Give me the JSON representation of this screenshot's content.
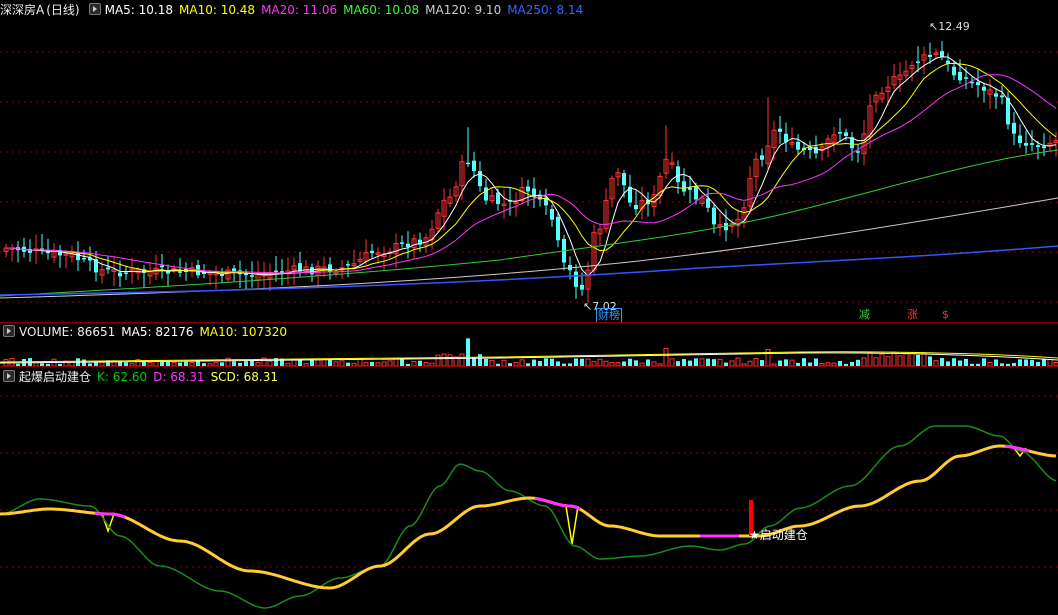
{
  "price_pane": {
    "stock_name": "深深房A",
    "period": "(日线)",
    "ma": [
      {
        "key": "MA5",
        "label": "MA5: 10.18",
        "color": "#ffffff"
      },
      {
        "key": "MA10",
        "label": "MA10: 10.48",
        "color": "#ffff00"
      },
      {
        "key": "MA20",
        "label": "MA20: 11.06",
        "color": "#ff00ff"
      },
      {
        "key": "MA60",
        "label": "MA60: 10.08",
        "color": "#00ff00"
      },
      {
        "key": "MA120",
        "label": "MA120: 9.10",
        "color": "#cccccc"
      },
      {
        "key": "MA250",
        "label": "MA250: 8.14",
        "color": "#3355ff"
      }
    ],
    "high_label": "12.49",
    "low_label": "7.02",
    "markers": [
      {
        "text": "财榜",
        "color": "#3399ff"
      },
      {
        "text": "减",
        "color": "#33cc33"
      },
      {
        "text": "涨",
        "color": "#ff3333"
      },
      {
        "text": "$",
        "color": "#ff3333"
      }
    ],
    "price_min": 6.6,
    "price_max": 12.7
  },
  "volume_pane": {
    "label": "VOLUME: 86651",
    "ma5": "MA5: 82176",
    "ma10": "MA10: 107320"
  },
  "indicator_pane": {
    "name": "起爆启动建仓",
    "k": "K: 62.60",
    "d": "D: 68.31",
    "scd": "SCD: 68.31",
    "signal_text": "启动建仓",
    "k_color": "#00cc00",
    "d_color": "#ff33ff",
    "scd_color": "#ffff66"
  },
  "colors": {
    "up": "#ff3333",
    "down": "#54ffff",
    "grid": "#8b0000",
    "k_line": "#1a8c1a",
    "d_line": "#ffcc33",
    "signal_bar": "#ff0000"
  }
}
